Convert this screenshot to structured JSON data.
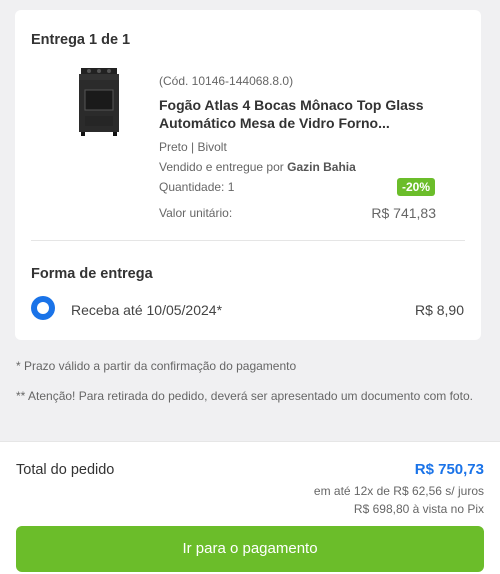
{
  "delivery": {
    "title": "Entrega 1 de 1",
    "product": {
      "code": "(Cód. 10146-144068.8.0)",
      "name": "Fogão Atlas 4 Bocas Mônaco Top Glass Automático Mesa de Vidro Forno...",
      "attributes": "Preto | Bivolt",
      "seller_prefix": "Vendido e entregue por",
      "seller_name": "Gazin Bahia",
      "quantity": "Quantidade: 1",
      "discount": "-20%",
      "unit_label": "Valor unitário:",
      "unit_price": "R$ 741,83"
    }
  },
  "shipping": {
    "title": "Forma de entrega",
    "option_text": "Receba até 10/05/2024*",
    "option_price": "R$ 8,90",
    "selected": true
  },
  "notes": {
    "note1": "* Prazo válido a partir da confirmação do pagamento",
    "note2": "** Atenção! Para retirada do pedido, deverá ser apresentado um documento com foto."
  },
  "summary": {
    "total_label": "Total do pedido",
    "total_value": "R$ 750,73",
    "installments": "em até 12x de R$ 62,56 s/ juros",
    "pix": "R$ 698,80 à vista no Pix"
  },
  "actions": {
    "pay_button": "Ir para o pagamento"
  },
  "colors": {
    "accent_blue": "#1a73e8",
    "accent_green": "#6bbd2a"
  }
}
